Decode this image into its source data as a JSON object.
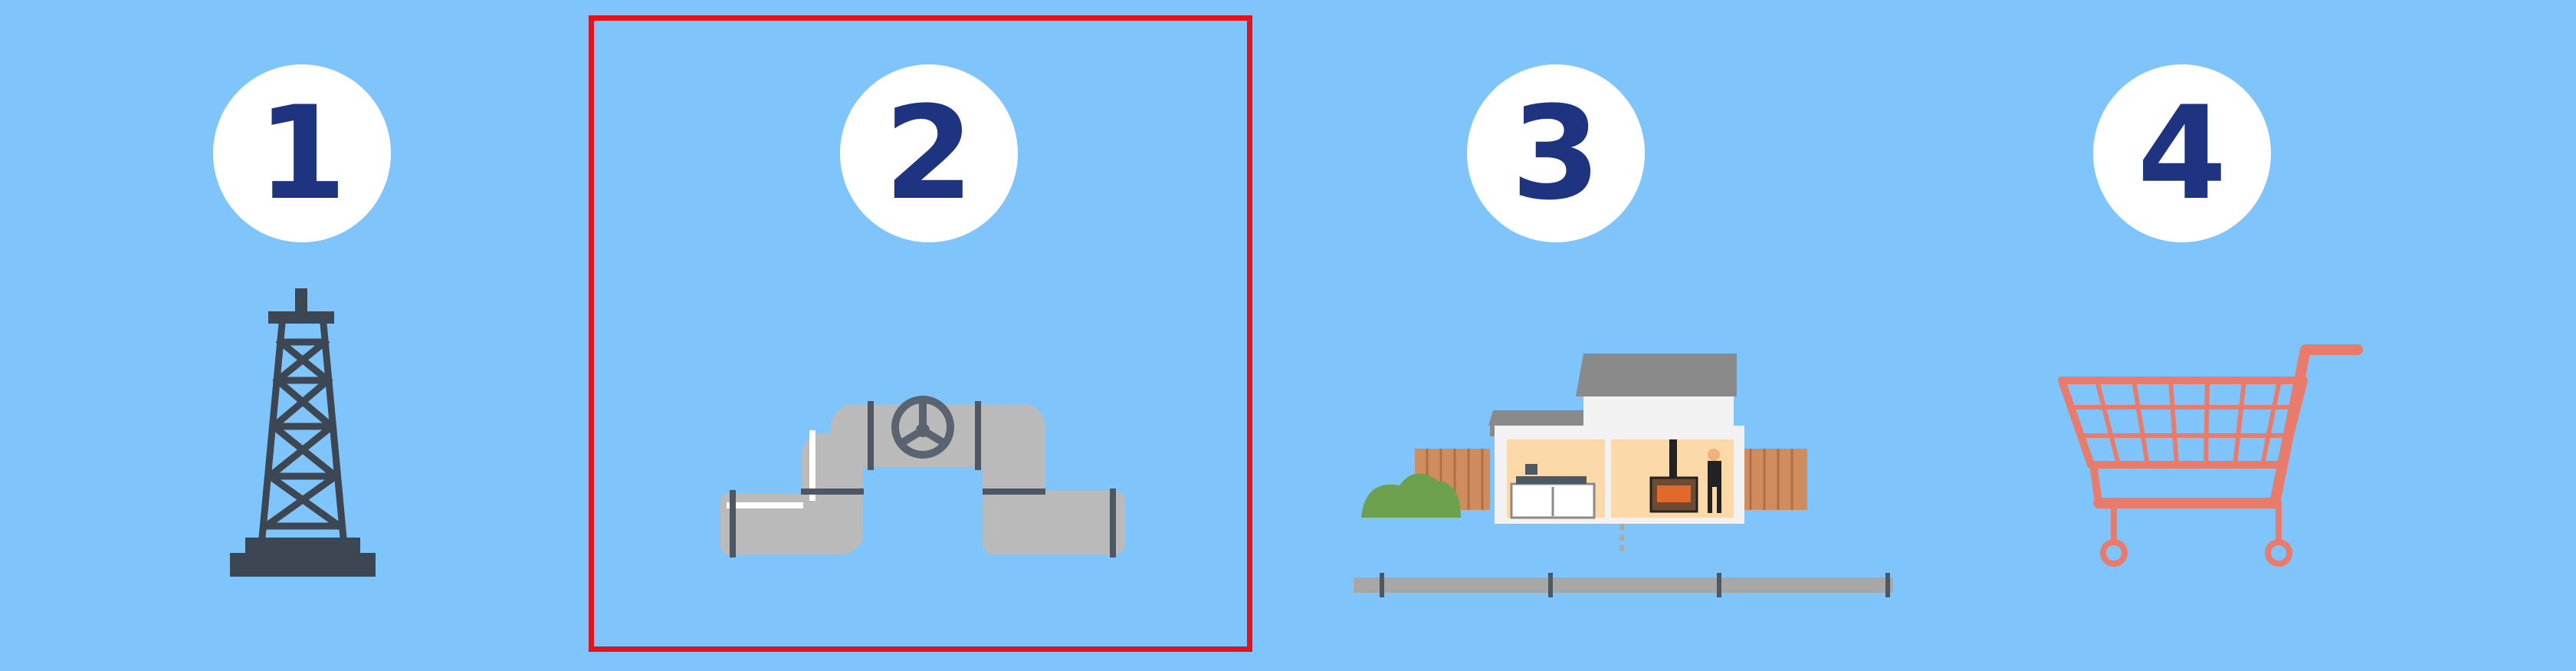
{
  "steps": [
    {
      "number": "1",
      "icon": "oil-derrick-icon"
    },
    {
      "number": "2",
      "icon": "pipeline-valve-icon"
    },
    {
      "number": "3",
      "icon": "house-gas-connection-icon"
    },
    {
      "number": "4",
      "icon": "shopping-cart-icon"
    }
  ],
  "selected_step": "2",
  "colors": {
    "background": "#80c4fc",
    "circle": "#ffffff",
    "number": "#1f3481",
    "highlight_border": "#e1141e",
    "derrick": "#3d4753",
    "pipe": "#bababa",
    "cart": "#e87b6c"
  }
}
